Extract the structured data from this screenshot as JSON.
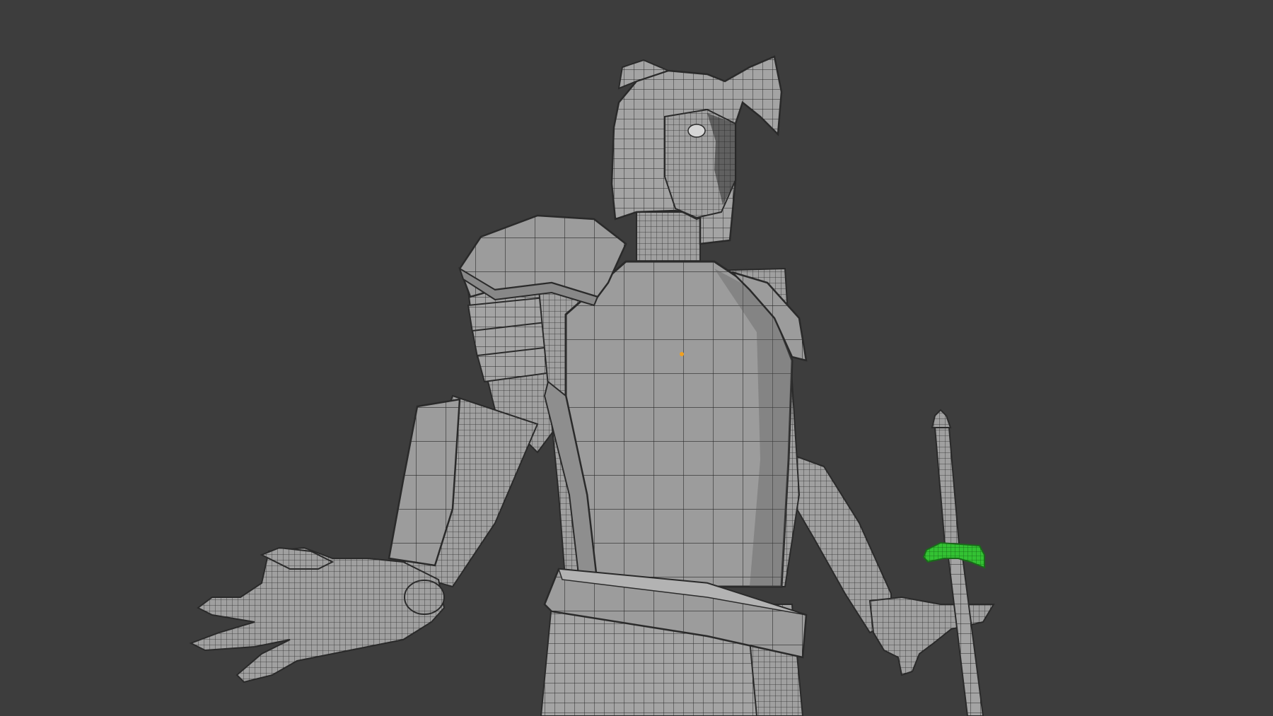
{
  "viewport": {
    "background_color": "#3d3d3d",
    "view": "3d-viewport-wireframe-overlay"
  },
  "model": {
    "subject": "armored-knight-mesh",
    "mesh_color": "#9a9a9a",
    "wire_color": "#2a2a2a",
    "selected_color": "#2fc12f",
    "origin_color": "#f0a020",
    "parts": [
      "helmet",
      "head",
      "pauldron",
      "arm-plates",
      "breastplate",
      "belt",
      "tassets",
      "left-hand",
      "right-hand",
      "sword"
    ],
    "selected_part": "sword-crossguard"
  }
}
